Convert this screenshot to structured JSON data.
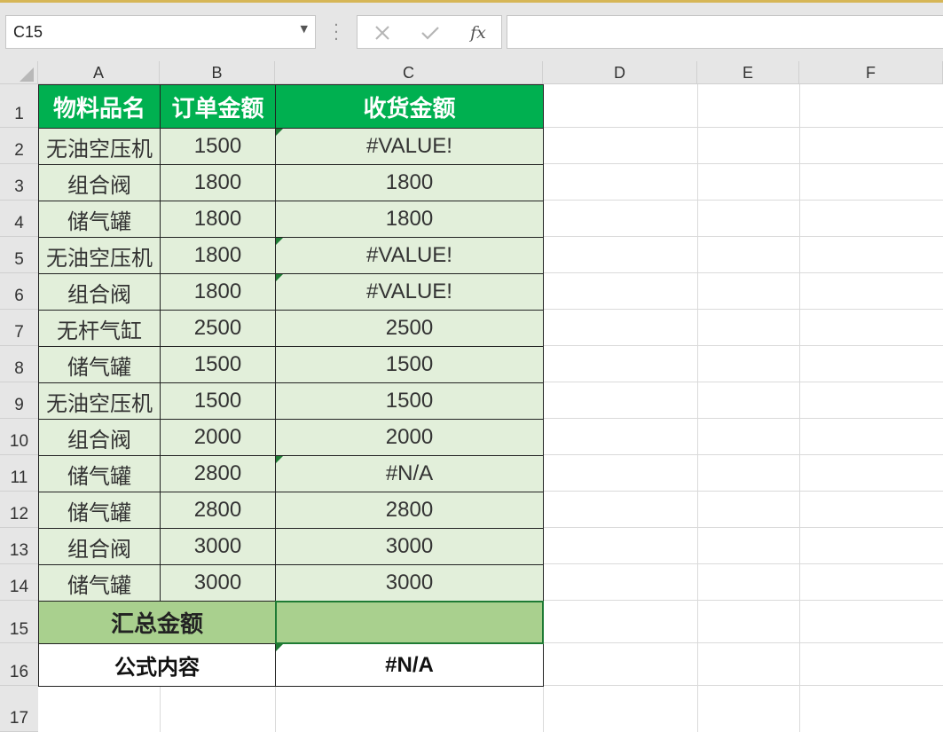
{
  "formula_bar": {
    "name_box": "C15",
    "cancel_icon": "close-icon",
    "enter_icon": "check-icon",
    "fx_label": "fx",
    "formula": ""
  },
  "columns": [
    "A",
    "B",
    "C",
    "D",
    "E",
    "F"
  ],
  "rows": [
    "1",
    "2",
    "3",
    "4",
    "5",
    "6",
    "7",
    "8",
    "9",
    "10",
    "11",
    "12",
    "13",
    "14",
    "15",
    "16",
    "17"
  ],
  "table": {
    "headers": [
      "物料品名",
      "订单金额",
      "收货金额"
    ],
    "data": [
      [
        "无油空压机",
        "1500",
        "#VALUE!"
      ],
      [
        "组合阀",
        "1800",
        "1800"
      ],
      [
        "储气罐",
        "1800",
        "1800"
      ],
      [
        "无油空压机",
        "1800",
        "#VALUE!"
      ],
      [
        "组合阀",
        "1800",
        "#VALUE!"
      ],
      [
        "无杆气缸",
        "2500",
        "2500"
      ],
      [
        "储气罐",
        "1500",
        "1500"
      ],
      [
        "无油空压机",
        "1500",
        "1500"
      ],
      [
        "组合阀",
        "2000",
        "2000"
      ],
      [
        "储气罐",
        "2800",
        "#N/A"
      ],
      [
        "储气罐",
        "2800",
        "2800"
      ],
      [
        "组合阀",
        "3000",
        "3000"
      ],
      [
        "储气罐",
        "3000",
        "3000"
      ]
    ],
    "summary_label": "汇总金额",
    "summary_value": "",
    "formula_label": "公式内容",
    "formula_value": "#N/A"
  },
  "colors": {
    "header_green": "#00b050",
    "data_fill": "#e2efda",
    "summary_fill": "#a9d08e",
    "error_flag": "#1e7b34"
  }
}
